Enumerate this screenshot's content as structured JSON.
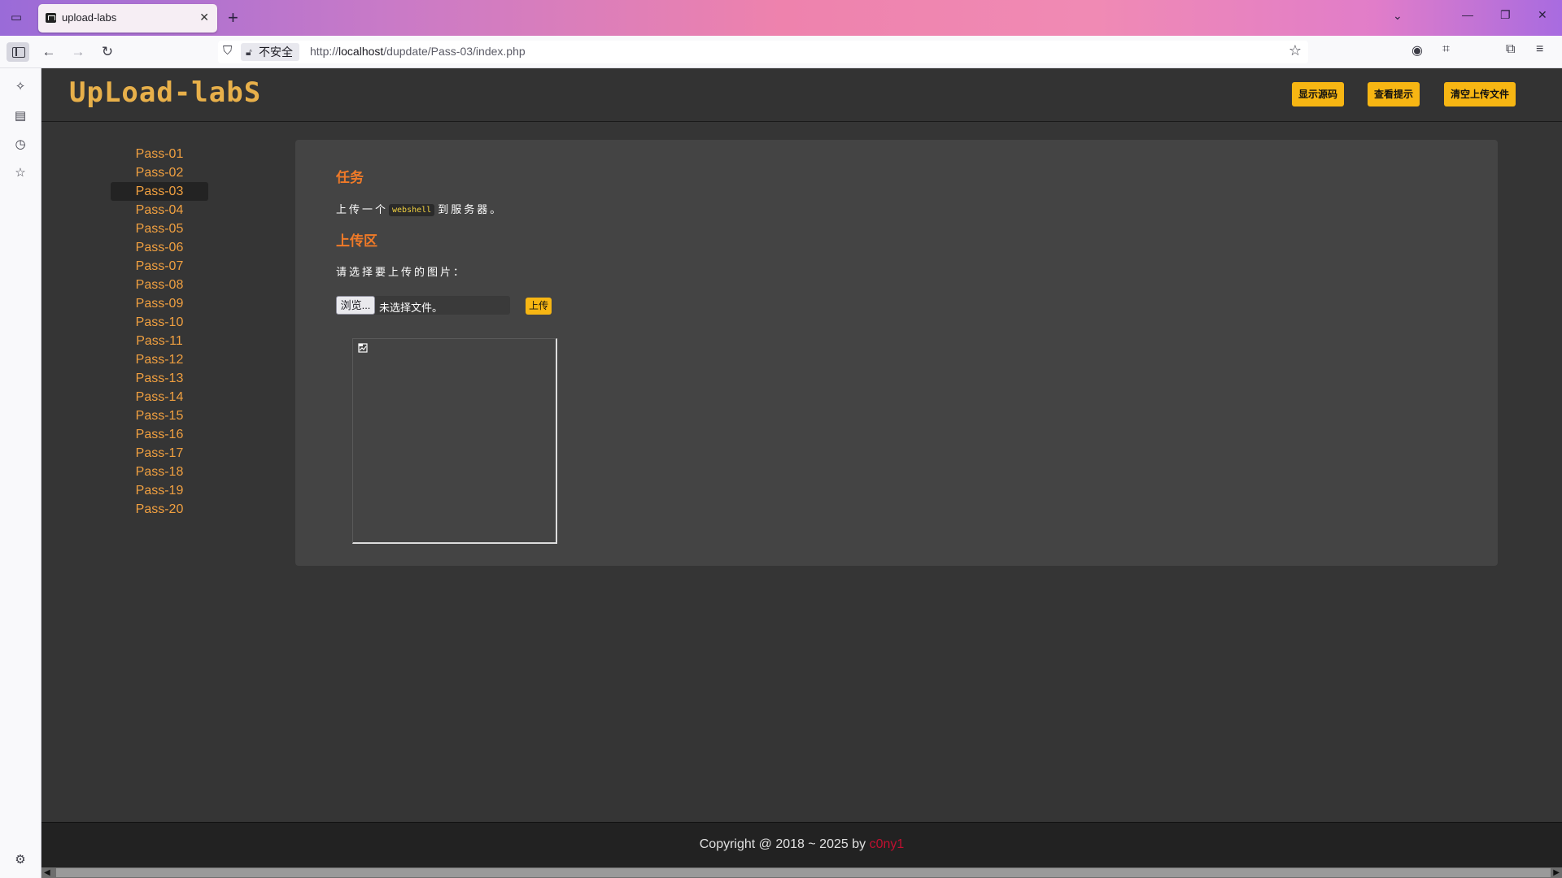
{
  "browser": {
    "tab_title": "upload-labs",
    "new_tab_symbol": "+",
    "tab_close_symbol": "✕",
    "security_label": "不安全",
    "url_prefix": "http://",
    "url_host": "localhost",
    "url_path": "/dupdate/Pass-03/index.php"
  },
  "site": {
    "logo_text": "UpLoad-labS",
    "header_buttons": {
      "show_source": "显示源码",
      "view_hint": "查看提示",
      "clear_uploads": "清空上传文件"
    },
    "menu": [
      {
        "label": "Pass-01"
      },
      {
        "label": "Pass-02"
      },
      {
        "label": "Pass-03"
      },
      {
        "label": "Pass-04"
      },
      {
        "label": "Pass-05"
      },
      {
        "label": "Pass-06"
      },
      {
        "label": "Pass-07"
      },
      {
        "label": "Pass-08"
      },
      {
        "label": "Pass-09"
      },
      {
        "label": "Pass-10"
      },
      {
        "label": "Pass-11"
      },
      {
        "label": "Pass-12"
      },
      {
        "label": "Pass-13"
      },
      {
        "label": "Pass-14"
      },
      {
        "label": "Pass-15"
      },
      {
        "label": "Pass-16"
      },
      {
        "label": "Pass-17"
      },
      {
        "label": "Pass-18"
      },
      {
        "label": "Pass-19"
      },
      {
        "label": "Pass-20"
      }
    ],
    "active_menu": "Pass-03"
  },
  "content": {
    "task_title": "任务",
    "task_before": "上传一个",
    "task_code": "webshell",
    "task_after": "到服务器。",
    "upload_title": "上传区",
    "prompt": "请选择要上传的图片：",
    "browse_label": "浏览...",
    "file_status": "未选择文件。",
    "upload_button": "上传"
  },
  "footer": {
    "copyright": "Copyright @ 2018 ~ 2025 by ",
    "author": "c0ny1"
  },
  "colors": {
    "accent_orange": "#f07a28",
    "menu_link": "#f1a040",
    "button_yellow": "#f7b613",
    "author_red": "#c01030"
  }
}
